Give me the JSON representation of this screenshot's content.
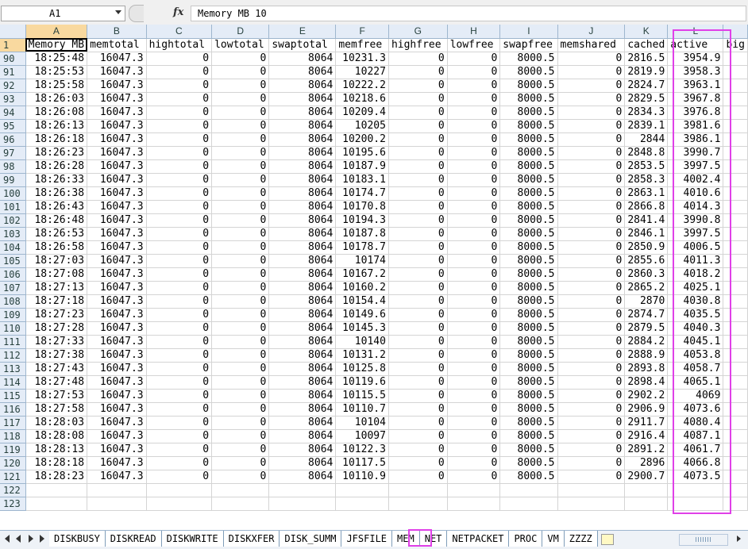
{
  "formula_bar": {
    "name_box": "A1",
    "fx_label": "fx",
    "formula": "Memory MB 10"
  },
  "columns": [
    "A",
    "B",
    "C",
    "D",
    "E",
    "F",
    "G",
    "H",
    "I",
    "J",
    "K",
    "L"
  ],
  "headers": [
    "Memory MB",
    "memtotal",
    "hightotal",
    "lowtotal",
    "swaptotal",
    "memfree",
    "highfree",
    "lowfree",
    "swapfree",
    "memshared",
    "cached",
    "active",
    "big"
  ],
  "rows": [
    [
      "90",
      "18:25:48",
      "16047.3",
      "0",
      "0",
      "8064",
      "10231.3",
      "0",
      "0",
      "8000.5",
      "0",
      "2816.5",
      "3954.9"
    ],
    [
      "91",
      "18:25:53",
      "16047.3",
      "0",
      "0",
      "8064",
      "10227",
      "0",
      "0",
      "8000.5",
      "0",
      "2819.9",
      "3958.3"
    ],
    [
      "92",
      "18:25:58",
      "16047.3",
      "0",
      "0",
      "8064",
      "10222.2",
      "0",
      "0",
      "8000.5",
      "0",
      "2824.7",
      "3963.1"
    ],
    [
      "93",
      "18:26:03",
      "16047.3",
      "0",
      "0",
      "8064",
      "10218.6",
      "0",
      "0",
      "8000.5",
      "0",
      "2829.5",
      "3967.8"
    ],
    [
      "94",
      "18:26:08",
      "16047.3",
      "0",
      "0",
      "8064",
      "10209.4",
      "0",
      "0",
      "8000.5",
      "0",
      "2834.3",
      "3976.8"
    ],
    [
      "95",
      "18:26:13",
      "16047.3",
      "0",
      "0",
      "8064",
      "10205",
      "0",
      "0",
      "8000.5",
      "0",
      "2839.1",
      "3981.6"
    ],
    [
      "96",
      "18:26:18",
      "16047.3",
      "0",
      "0",
      "8064",
      "10200.2",
      "0",
      "0",
      "8000.5",
      "0",
      "2844",
      "3986.1"
    ],
    [
      "97",
      "18:26:23",
      "16047.3",
      "0",
      "0",
      "8064",
      "10195.6",
      "0",
      "0",
      "8000.5",
      "0",
      "2848.8",
      "3990.7"
    ],
    [
      "98",
      "18:26:28",
      "16047.3",
      "0",
      "0",
      "8064",
      "10187.9",
      "0",
      "0",
      "8000.5",
      "0",
      "2853.5",
      "3997.5"
    ],
    [
      "99",
      "18:26:33",
      "16047.3",
      "0",
      "0",
      "8064",
      "10183.1",
      "0",
      "0",
      "8000.5",
      "0",
      "2858.3",
      "4002.4"
    ],
    [
      "100",
      "18:26:38",
      "16047.3",
      "0",
      "0",
      "8064",
      "10174.7",
      "0",
      "0",
      "8000.5",
      "0",
      "2863.1",
      "4010.6"
    ],
    [
      "101",
      "18:26:43",
      "16047.3",
      "0",
      "0",
      "8064",
      "10170.8",
      "0",
      "0",
      "8000.5",
      "0",
      "2866.8",
      "4014.3"
    ],
    [
      "102",
      "18:26:48",
      "16047.3",
      "0",
      "0",
      "8064",
      "10194.3",
      "0",
      "0",
      "8000.5",
      "0",
      "2841.4",
      "3990.8"
    ],
    [
      "103",
      "18:26:53",
      "16047.3",
      "0",
      "0",
      "8064",
      "10187.8",
      "0",
      "0",
      "8000.5",
      "0",
      "2846.1",
      "3997.5"
    ],
    [
      "104",
      "18:26:58",
      "16047.3",
      "0",
      "0",
      "8064",
      "10178.7",
      "0",
      "0",
      "8000.5",
      "0",
      "2850.9",
      "4006.5"
    ],
    [
      "105",
      "18:27:03",
      "16047.3",
      "0",
      "0",
      "8064",
      "10174",
      "0",
      "0",
      "8000.5",
      "0",
      "2855.6",
      "4011.3"
    ],
    [
      "106",
      "18:27:08",
      "16047.3",
      "0",
      "0",
      "8064",
      "10167.2",
      "0",
      "0",
      "8000.5",
      "0",
      "2860.3",
      "4018.2"
    ],
    [
      "107",
      "18:27:13",
      "16047.3",
      "0",
      "0",
      "8064",
      "10160.2",
      "0",
      "0",
      "8000.5",
      "0",
      "2865.2",
      "4025.1"
    ],
    [
      "108",
      "18:27:18",
      "16047.3",
      "0",
      "0",
      "8064",
      "10154.4",
      "0",
      "0",
      "8000.5",
      "0",
      "2870",
      "4030.8"
    ],
    [
      "109",
      "18:27:23",
      "16047.3",
      "0",
      "0",
      "8064",
      "10149.6",
      "0",
      "0",
      "8000.5",
      "0",
      "2874.7",
      "4035.5"
    ],
    [
      "110",
      "18:27:28",
      "16047.3",
      "0",
      "0",
      "8064",
      "10145.3",
      "0",
      "0",
      "8000.5",
      "0",
      "2879.5",
      "4040.3"
    ],
    [
      "111",
      "18:27:33",
      "16047.3",
      "0",
      "0",
      "8064",
      "10140",
      "0",
      "0",
      "8000.5",
      "0",
      "2884.2",
      "4045.1"
    ],
    [
      "112",
      "18:27:38",
      "16047.3",
      "0",
      "0",
      "8064",
      "10131.2",
      "0",
      "0",
      "8000.5",
      "0",
      "2888.9",
      "4053.8"
    ],
    [
      "113",
      "18:27:43",
      "16047.3",
      "0",
      "0",
      "8064",
      "10125.8",
      "0",
      "0",
      "8000.5",
      "0",
      "2893.8",
      "4058.7"
    ],
    [
      "114",
      "18:27:48",
      "16047.3",
      "0",
      "0",
      "8064",
      "10119.6",
      "0",
      "0",
      "8000.5",
      "0",
      "2898.4",
      "4065.1"
    ],
    [
      "115",
      "18:27:53",
      "16047.3",
      "0",
      "0",
      "8064",
      "10115.5",
      "0",
      "0",
      "8000.5",
      "0",
      "2902.2",
      "4069"
    ],
    [
      "116",
      "18:27:58",
      "16047.3",
      "0",
      "0",
      "8064",
      "10110.7",
      "0",
      "0",
      "8000.5",
      "0",
      "2906.9",
      "4073.6"
    ],
    [
      "117",
      "18:28:03",
      "16047.3",
      "0",
      "0",
      "8064",
      "10104",
      "0",
      "0",
      "8000.5",
      "0",
      "2911.7",
      "4080.4"
    ],
    [
      "118",
      "18:28:08",
      "16047.3",
      "0",
      "0",
      "8064",
      "10097",
      "0",
      "0",
      "8000.5",
      "0",
      "2916.4",
      "4087.1"
    ],
    [
      "119",
      "18:28:13",
      "16047.3",
      "0",
      "0",
      "8064",
      "10122.3",
      "0",
      "0",
      "8000.5",
      "0",
      "2891.2",
      "4061.7"
    ],
    [
      "120",
      "18:28:18",
      "16047.3",
      "0",
      "0",
      "8064",
      "10117.5",
      "0",
      "0",
      "8000.5",
      "0",
      "2896",
      "4066.8"
    ],
    [
      "121",
      "18:28:23",
      "16047.3",
      "0",
      "0",
      "8064",
      "10110.9",
      "0",
      "0",
      "8000.5",
      "0",
      "2900.7",
      "4073.5"
    ]
  ],
  "empty_rows": [
    "122",
    "123"
  ],
  "sheet_tabs": [
    "DISKBUSY",
    "DISKREAD",
    "DISKWRITE",
    "DISKXFER",
    "DISK_SUMM",
    "JFSFILE",
    "MEM",
    "NET",
    "NETPACKET",
    "PROC",
    "VM",
    "ZZZZ"
  ],
  "active_tab": "MEM",
  "highlight_color": "#e040e8"
}
